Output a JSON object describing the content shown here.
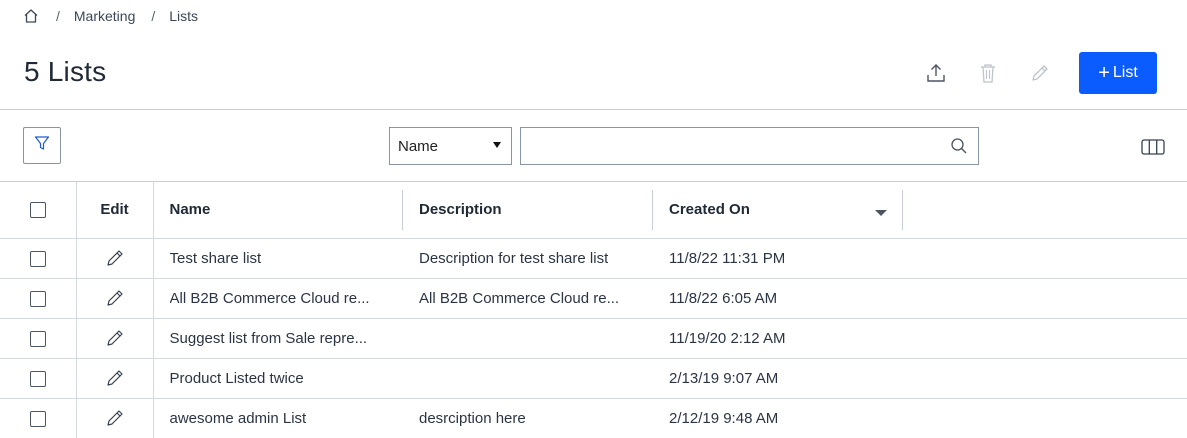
{
  "breadcrumb": {
    "home_icon": "home-icon",
    "separator": "/",
    "items": [
      "Marketing",
      "Lists"
    ]
  },
  "header": {
    "title": "5 Lists",
    "actions": {
      "export_icon": "export-icon",
      "delete_icon": "trash-icon",
      "edit_icon": "pencil-icon",
      "add_button_label": "List",
      "add_button_plus": "+"
    },
    "accent_color": "#0b5cff"
  },
  "toolbar": {
    "filter_icon": "filter-icon",
    "field_select": {
      "value": "Name"
    },
    "search": {
      "value": "",
      "placeholder": ""
    },
    "columns_icon": "columns-icon"
  },
  "table": {
    "columns": [
      "Edit",
      "Name",
      "Description",
      "Created On"
    ],
    "sort": {
      "column": "Created On",
      "direction": "desc"
    },
    "rows": [
      {
        "name": "Test share list",
        "description": "Description for test share list",
        "created_on": "11/8/22 11:31 PM"
      },
      {
        "name": "All B2B Commerce Cloud re...",
        "description": "All B2B Commerce Cloud re...",
        "created_on": "11/8/22 6:05 AM"
      },
      {
        "name": "Suggest list from Sale repre...",
        "description": "",
        "created_on": "11/19/20 2:12 AM"
      },
      {
        "name": "Product Listed twice",
        "description": "",
        "created_on": "2/13/19 9:07 AM"
      },
      {
        "name": "awesome admin List",
        "description": "desrciption here",
        "created_on": "2/12/19 9:48 AM"
      }
    ]
  }
}
